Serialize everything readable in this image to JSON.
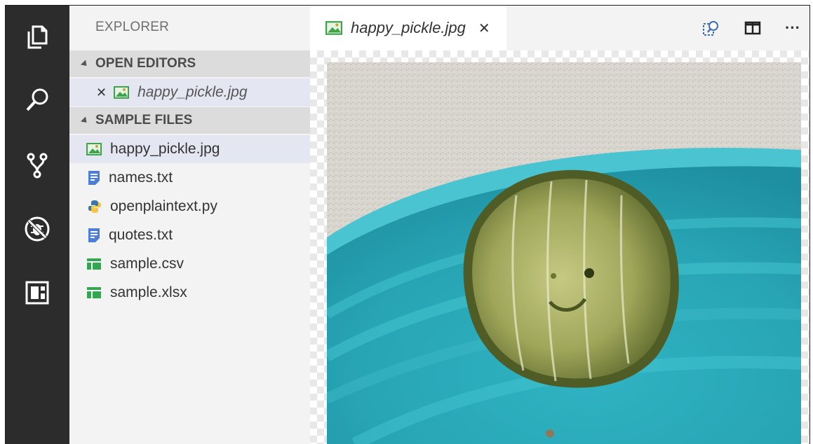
{
  "sidebar": {
    "title": "EXPLORER",
    "open_editors": {
      "label": "OPEN EDITORS",
      "items": [
        {
          "name": "happy_pickle.jpg",
          "icon": "image-file-icon"
        }
      ]
    },
    "sample_files": {
      "label": "SAMPLE FILES",
      "items": [
        {
          "name": "happy_pickle.jpg",
          "icon": "image-file-icon"
        },
        {
          "name": "names.txt",
          "icon": "text-file-icon"
        },
        {
          "name": "openplaintext.py",
          "icon": "python-file-icon"
        },
        {
          "name": "quotes.txt",
          "icon": "text-file-icon"
        },
        {
          "name": "sample.csv",
          "icon": "spreadsheet-file-icon"
        },
        {
          "name": "sample.xlsx",
          "icon": "spreadsheet-file-icon"
        }
      ]
    }
  },
  "editor": {
    "tab": {
      "label": "happy_pickle.jpg",
      "close_glyph": "✕"
    },
    "actions": {
      "more_label": "···"
    }
  },
  "activity_bar": [
    "files-icon",
    "search-icon",
    "source-control-icon",
    "debug-icon",
    "extensions-icon"
  ],
  "colors": {
    "activity_bg": "#2c2c2c",
    "sidebar_bg": "#f3f3f3",
    "section_bg": "#dcdcdc",
    "selected_bg": "#e4e6f1",
    "text_icon_blue": "#4c7ed6",
    "spreadsheet_green": "#2fa84f"
  }
}
